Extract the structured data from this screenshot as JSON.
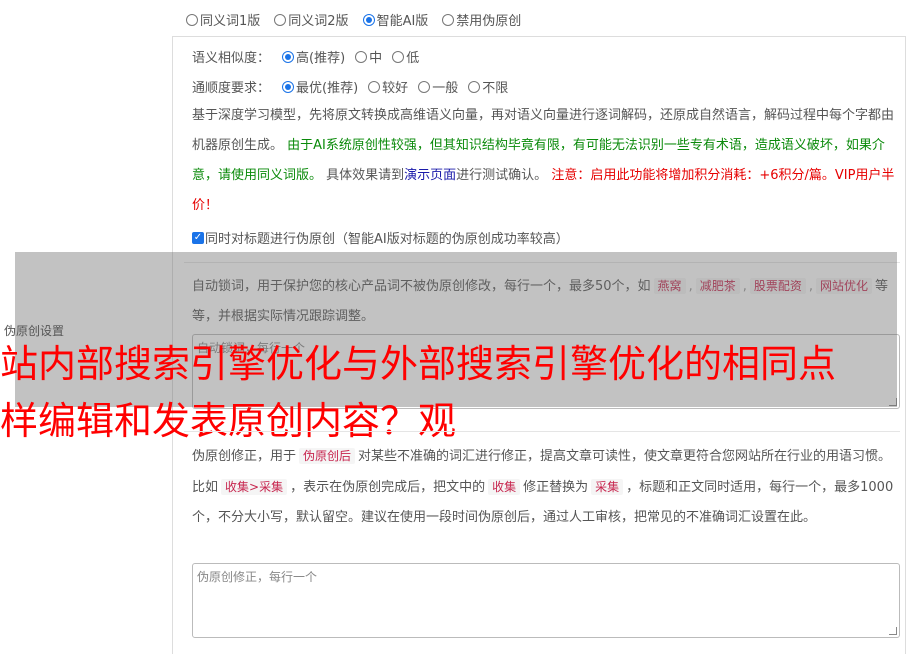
{
  "mode_options": [
    {
      "label": "同义词1版",
      "selected": false
    },
    {
      "label": "同义词2版",
      "selected": false
    },
    {
      "label": "智能AI版",
      "selected": true
    },
    {
      "label": "禁用伪原创",
      "selected": false
    }
  ],
  "similarity": {
    "label": "语义相似度：",
    "options": [
      {
        "label": "高(推荐)",
        "selected": true
      },
      {
        "label": "中",
        "selected": false
      },
      {
        "label": "低",
        "selected": false
      }
    ]
  },
  "fluency": {
    "label": "通顺度要求：",
    "options": [
      {
        "label": "最优(推荐)",
        "selected": true
      },
      {
        "label": "较好",
        "selected": false
      },
      {
        "label": "一般",
        "selected": false
      },
      {
        "label": "不限",
        "selected": false
      }
    ]
  },
  "ai_desc": {
    "part1": "基于深度学习模型，先将原文转换成高维语义向量，再对语义向量进行逐词解码，还原成自然语言，解码过程中每个字都由机器原创生成。 ",
    "part2_green": "由于AI系统原创性较强，但其知识结构毕竟有限，有可能无法识别一些专有术语，造成语义破坏，如果介意，请使用同义词版。",
    "part3": " 具体效果请到",
    "link": "演示页面",
    "part4": "进行测试确认。 ",
    "part5_red": "注意：启用此功能将增加积分消耗：+6积分/篇。VIP用户半价！"
  },
  "title_checkbox": {
    "checked": true,
    "label": "同时对标题进行伪原创（智能AI版对标题的伪原创成功率较高）"
  },
  "lock_words": {
    "text1": "自动锁词，用于保护您的核心产品词不被伪原创修改，每行一个，最多50个，如",
    "examples": [
      "燕窝",
      "减肥茶",
      "股票配资",
      "网站优化"
    ],
    "text2": "等等，并根据实际情况跟踪调整。",
    "placeholder": "自动锁词，每行一个"
  },
  "side_label": "伪原创设置",
  "banner": {
    "line1": "站内部搜索引擎优化与外部搜索引擎优化的相同点",
    "line2": "样编辑和发表原创内容？观"
  },
  "correction": {
    "text1": "伪原创修正，用于",
    "tag1": "伪原创后",
    "text2": "对某些不准确的词汇进行修正，提高文章可读性，使文章更符合您网站所在行业的用语习惯。比如",
    "tag2": "收集>采集",
    "text3": "，表示在伪原创完成后，把文中的",
    "tag3": "收集",
    "text4": "修正替换为",
    "tag4": "采集",
    "text5": "，标题和正文同时适用，每行一个，最多1000个，不分大小写，默认留空。建议在使用一段时间伪原创后，通过人工审核，把常见的不准确词汇设置在此。",
    "placeholder": "伪原创修正，每行一个"
  },
  "colors": {
    "accent": "#1a73e8",
    "green": "#0a8a0a",
    "red": "#e60000",
    "link": "#1a1aaa"
  }
}
